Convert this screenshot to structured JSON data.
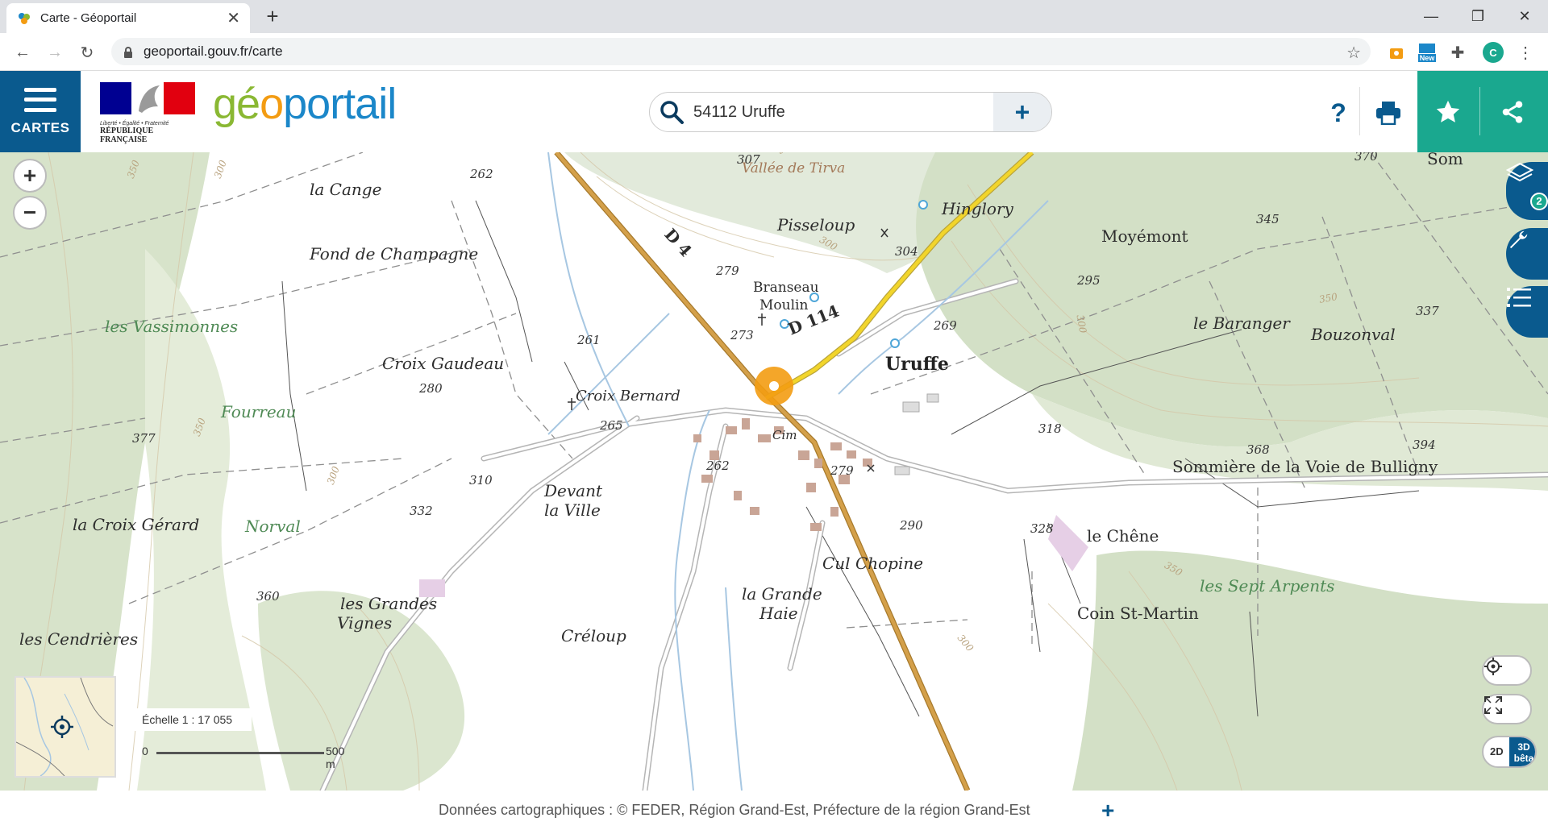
{
  "browser": {
    "tab_title": "Carte - Géoportail",
    "url": "geoportail.gouv.fr/carte",
    "profile_initial": "C",
    "ext_new_label": "New"
  },
  "header": {
    "menu_label": "CARTES",
    "logo_parts": [
      "gé",
      "o",
      "portail"
    ],
    "marianne_lines": [
      "Liberté • Égalité • Fraternité",
      "RÉPUBLIQUE FRANÇAISE"
    ],
    "search_value": "54112 Uruffe",
    "help_label": "?"
  },
  "map": {
    "layer_count": "2",
    "place_labels": [
      {
        "text": "la Cange",
        "style": "normal"
      },
      {
        "text": "Fond de Champagne",
        "style": "normal"
      },
      {
        "text": "les Vassimonnes",
        "style": "green"
      },
      {
        "text": "Croix Gaudeau",
        "style": "normal"
      },
      {
        "text": "Fourreau",
        "style": "green"
      },
      {
        "text": "Croix Bernard",
        "style": "normal"
      },
      {
        "text": "Devant",
        "style": "normal"
      },
      {
        "text": "la Ville",
        "style": "normal"
      },
      {
        "text": "la Croix Gérard",
        "style": "normal"
      },
      {
        "text": "Norval",
        "style": "green"
      },
      {
        "text": "les Grandes",
        "style": "normal"
      },
      {
        "text": "Vignes",
        "style": "normal"
      },
      {
        "text": "les Cendrières",
        "style": "normal"
      },
      {
        "text": "Créloup",
        "style": "normal"
      },
      {
        "text": "la Grande",
        "style": "normal"
      },
      {
        "text": "Haie",
        "style": "normal"
      },
      {
        "text": "Cul Chopine",
        "style": "normal"
      },
      {
        "text": "Vallée de Tirva",
        "style": "brown"
      },
      {
        "text": "Pisseloup",
        "style": "normal"
      },
      {
        "text": "Hinglory",
        "style": "normal"
      },
      {
        "text": "Branseau",
        "style": "normal"
      },
      {
        "text": "Moulin",
        "style": "normal"
      },
      {
        "text": "Uruffe",
        "style": "bold"
      },
      {
        "text": "Cim",
        "style": "normal"
      },
      {
        "text": "Moyémont",
        "style": "normal"
      },
      {
        "text": "le Baranger",
        "style": "normal"
      },
      {
        "text": "Bouzonval",
        "style": "normal"
      },
      {
        "text": "Sommière de la Voie de Bulligny",
        "style": "normal"
      },
      {
        "text": "le Chêne",
        "style": "normal"
      },
      {
        "text": "les Sept Arpents",
        "style": "green"
      },
      {
        "text": "Coin St-Martin",
        "style": "normal"
      },
      {
        "text": "Som",
        "style": "normal"
      }
    ],
    "road_labels": [
      "D 4",
      "D 114"
    ],
    "altitudes": [
      "307",
      "262",
      "279",
      "304",
      "273",
      "269",
      "261",
      "280",
      "265",
      "377",
      "310",
      "332",
      "262",
      "279",
      "290",
      "318",
      "368",
      "394",
      "328",
      "295",
      "345",
      "370",
      "337",
      "360"
    ],
    "contour_labels": [
      "300",
      "350",
      "300",
      "350",
      "300",
      "300",
      "300",
      "350",
      "350",
      "300"
    ]
  },
  "scale": {
    "label": "Échelle 1 : 17 055",
    "zero": "0",
    "distance": "500 m"
  },
  "attribution": {
    "text": "Données cartographiques : ©    FEDER,  Région Grand-Est,  Préfecture de la région Grand-Est"
  },
  "view_toggle": {
    "two_d": "2D",
    "three_d": "3D",
    "beta": "bêta"
  },
  "colors": {
    "brand_blue": "#0a5a8e",
    "teal": "#1aa88f",
    "road_yellow": "#f2d52b",
    "road_orange": "#d4a04a",
    "marker_orange": "#f39c12"
  }
}
